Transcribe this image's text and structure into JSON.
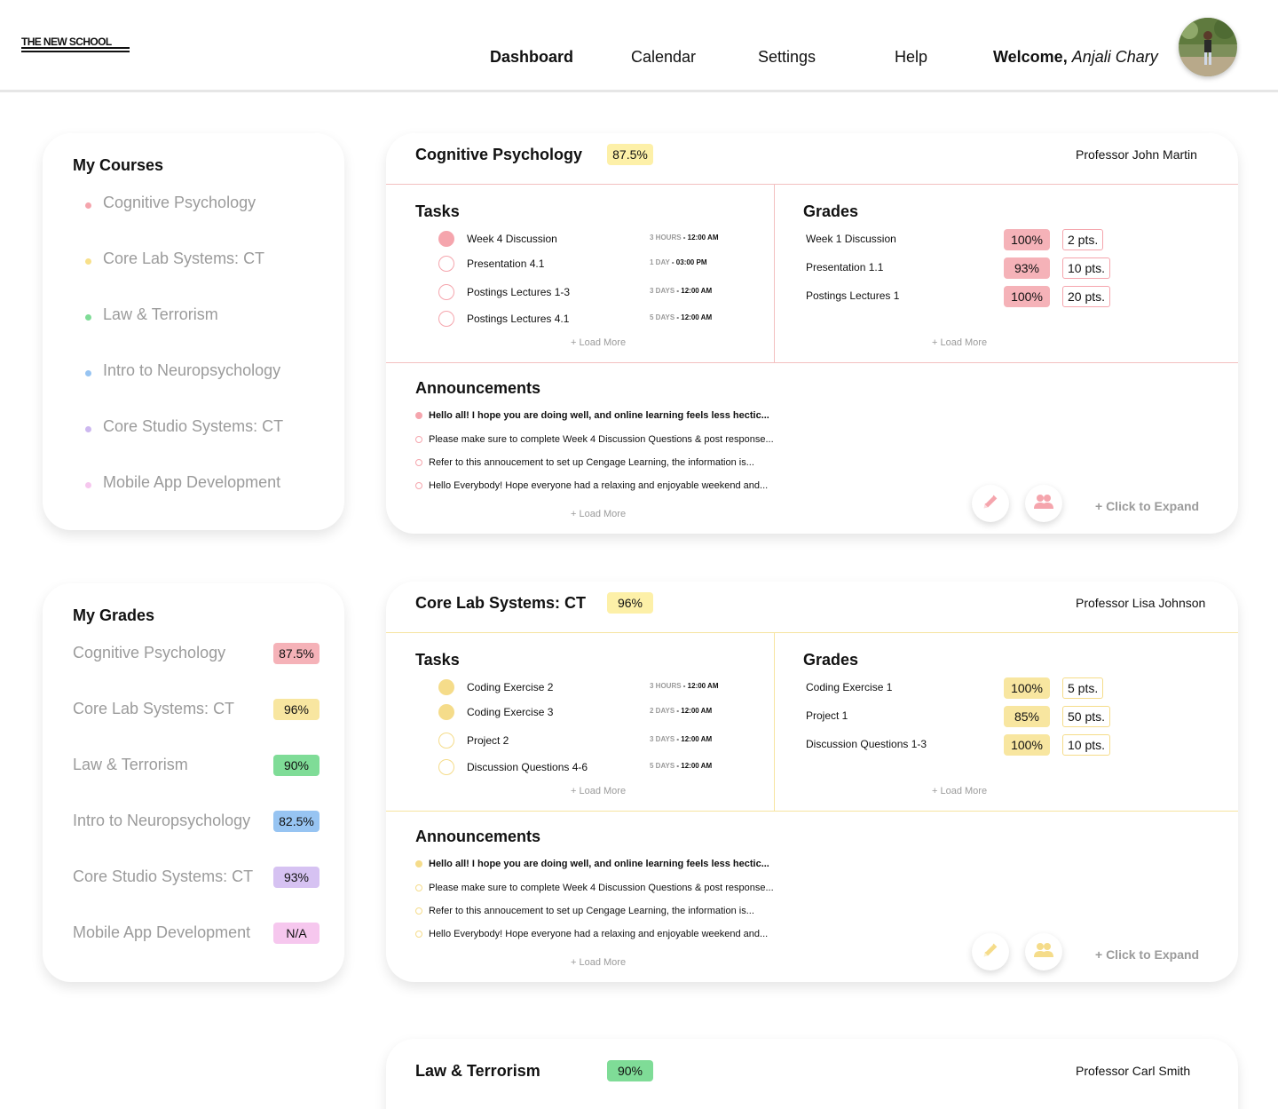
{
  "colors": {
    "red": "#f5b2b8",
    "yellow": "#fdf0a8",
    "yellow_badge": "#f8e6a0",
    "green": "#7fdc97",
    "blue": "#97c4f2",
    "purple": "#d6c2f2",
    "pink": "#f6c7ee",
    "red_line": "#f3c0c0",
    "yellow_line": "#f6e4a0",
    "red_icon": "#f5a5ad",
    "yellow_icon": "#f5dc8a"
  },
  "header": {
    "logo": "THE NEW SCHOOL",
    "nav": [
      "Dashboard",
      "Calendar",
      "Settings",
      "Help"
    ],
    "welcome_label": "Welcome,",
    "user_name": "Anjali Chary"
  },
  "courses_panel": {
    "title": "My Courses",
    "items": [
      {
        "label": "Cognitive Psychology",
        "color": "#f5a5ad"
      },
      {
        "label": "Core Lab Systems: CT",
        "color": "#f8e08a"
      },
      {
        "label": "Law & Terrorism",
        "color": "#7fdc97"
      },
      {
        "label": "Intro to Neuropsychology",
        "color": "#97c4f2"
      },
      {
        "label": "Core Studio Systems: CT",
        "color": "#cdb8f0"
      },
      {
        "label": "Mobile App Development",
        "color": "#f6c7ee"
      }
    ]
  },
  "grades_panel": {
    "title": "My Grades",
    "items": [
      {
        "label": "Cognitive Psychology",
        "value": "87.5%",
        "color": "#f5b2b8"
      },
      {
        "label": "Core Lab Systems: CT",
        "value": "96%",
        "color": "#f8e6a0"
      },
      {
        "label": "Law & Terrorism",
        "value": "90%",
        "color": "#7fdc97"
      },
      {
        "label": "Intro to Neuropsychology",
        "value": "82.5%",
        "color": "#97c4f2"
      },
      {
        "label": "Core Studio Systems: CT",
        "value": "93%",
        "color": "#d6c2f2"
      },
      {
        "label": "Mobile App Development",
        "value": "N/A",
        "color": "#f6c7ee"
      }
    ]
  },
  "course_cards": [
    {
      "title": "Cognitive Psychology",
      "grade": "87.5%",
      "professor": "Professor John Martin",
      "tasks_title": "Tasks",
      "tasks": [
        {
          "name": "Week 4 Discussion",
          "due_rel": "3 HOURS",
          "due_time": "12:00 AM",
          "done": true
        },
        {
          "name": "Presentation 4.1",
          "due_rel": "1 DAY",
          "due_time": "03:00 PM",
          "done": false
        },
        {
          "name": "Postings Lectures 1-3",
          "due_rel": "3 DAYS",
          "due_time": "12:00 AM",
          "done": false
        },
        {
          "name": "Postings Lectures 4.1",
          "due_rel": "5 DAYS",
          "due_time": "12:00 AM",
          "done": false
        }
      ],
      "grades_title": "Grades",
      "grades": [
        {
          "name": "Week 1 Discussion",
          "pct": "100%",
          "pts": "2 pts."
        },
        {
          "name": "Presentation 1.1",
          "pct": "93%",
          "pts": "10 pts."
        },
        {
          "name": "Postings Lectures 1",
          "pct": "100%",
          "pts": "20 pts."
        }
      ],
      "announcements_title": "Announcements",
      "announcements": [
        {
          "text": "Hello all! I hope you are doing well, and online learning feels less hectic...",
          "unread": true
        },
        {
          "text": "Please make sure to complete Week 4 Discussion Questions & post response...",
          "unread": false
        },
        {
          "text": "Refer to this annoucement to set up Cengage Learning, the information is...",
          "unread": false
        },
        {
          "text": "Hello Everybody! Hope everyone had a relaxing and enjoyable weekend and...",
          "unread": false
        }
      ],
      "load_more": "+ Load More",
      "expand": "+ Click to Expand",
      "icons": [
        "pencil-icon",
        "group-icon"
      ]
    },
    {
      "title": "Core Lab Systems: CT",
      "grade": "96%",
      "professor": "Professor Lisa Johnson",
      "tasks_title": "Tasks",
      "tasks": [
        {
          "name": "Coding Exercise 2",
          "due_rel": "3 HOURS",
          "due_time": "12:00 AM",
          "done": true
        },
        {
          "name": "Coding Exercise 3",
          "due_rel": "2 DAYS",
          "due_time": "12:00 AM",
          "done": true
        },
        {
          "name": "Project 2",
          "due_rel": "3 DAYS",
          "due_time": "12:00 AM",
          "done": false
        },
        {
          "name": "Discussion Questions 4-6",
          "due_rel": "5 DAYS",
          "due_time": "12:00 AM",
          "done": false
        }
      ],
      "grades_title": "Grades",
      "grades": [
        {
          "name": "Coding Exercise 1",
          "pct": "100%",
          "pts": "5 pts."
        },
        {
          "name": "Project 1",
          "pct": "85%",
          "pts": "50 pts."
        },
        {
          "name": "Discussion Questions 1-3",
          "pct": "100%",
          "pts": "10 pts."
        }
      ],
      "announcements_title": "Announcements",
      "announcements": [
        {
          "text": "Hello all! I hope you are doing well, and online learning feels less hectic...",
          "unread": true
        },
        {
          "text": "Please make sure to complete Week 4 Discussion Questions & post response...",
          "unread": false
        },
        {
          "text": "Refer to this annoucement to set up Cengage Learning, the information is...",
          "unread": false
        },
        {
          "text": "Hello Everybody! Hope everyone had a relaxing and enjoyable weekend and...",
          "unread": false
        }
      ],
      "load_more": "+ Load More",
      "expand": "+ Click to Expand",
      "icons": [
        "pencil-icon",
        "group-icon"
      ]
    },
    {
      "title": "Law & Terrorism",
      "grade": "90%",
      "professor": "Professor Carl Smith"
    }
  ]
}
